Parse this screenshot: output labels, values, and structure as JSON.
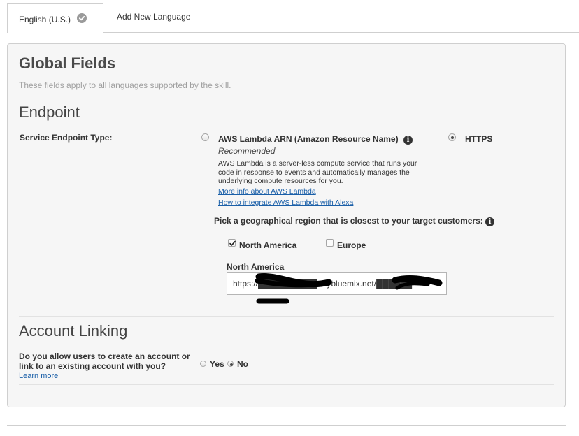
{
  "tabs": {
    "active_label": "English (U.S.)",
    "second_label": "Add New Language"
  },
  "global": {
    "title": "Global Fields",
    "subtitle": "These fields apply to all languages supported by the skill."
  },
  "endpoint": {
    "heading": "Endpoint",
    "type_label": "Service Endpoint Type:",
    "lambda_label": "AWS Lambda ARN (Amazon Resource Name)",
    "lambda_selected": false,
    "recommended": "Recommended",
    "lambda_desc": "AWS Lambda is a server-less compute service that runs your code in response to events and automatically manages the underlying compute resources for you.",
    "link_more_info": "More info about AWS Lambda",
    "link_integrate": "How to integrate AWS Lambda with Alexa",
    "https_label": "HTTPS",
    "https_selected": true,
    "region_prompt": "Pick a geographical region that is closest to your target customers:",
    "region_na_label": "North America",
    "region_na_checked": true,
    "region_eu_label": "Europe",
    "region_eu_checked": false,
    "na_field_label": "North America",
    "na_field_value": "https://██████████.mybluemix.net/██████"
  },
  "account_linking": {
    "heading": "Account Linking",
    "question": "Do you allow users to create an account or link to an existing account with you?",
    "learn_more": "Learn more",
    "yes_label": "Yes",
    "no_label": "No",
    "selected": "No"
  },
  "colors": {
    "link": "#1a5fa8",
    "panel_bg": "#f6f6f6",
    "border": "#cfcfcf"
  }
}
